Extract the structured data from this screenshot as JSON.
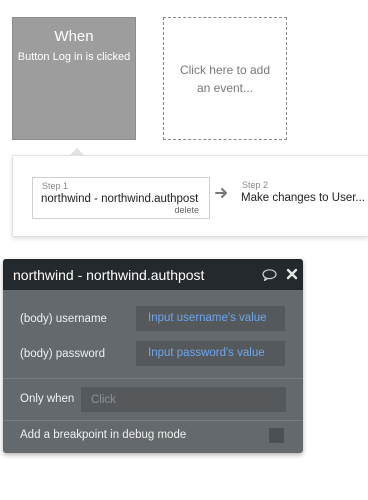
{
  "trigger": {
    "title": "When",
    "subtitle": "Button Log in is clicked"
  },
  "add_event": {
    "label": "Click here to add an event..."
  },
  "steps": [
    {
      "number": "Step 1",
      "title": "northwind - northwind.authpost",
      "delete_label": "delete"
    },
    {
      "number": "Step 2",
      "title": "Make changes to User..."
    }
  ],
  "inspector": {
    "title": "northwind - northwind.authpost",
    "params": [
      {
        "label": "(body) username",
        "value": "Input username's value"
      },
      {
        "label": "(body) password",
        "value": "Input password's value"
      }
    ],
    "only_when_label": "Only when",
    "only_when_placeholder": "Click",
    "breakpoint_label": "Add a breakpoint in debug mode",
    "icons": {
      "comment": "comment-icon",
      "close": "close-icon"
    }
  },
  "colors": {
    "trigger_bg": "#9d9d9d",
    "inspector_header": "#24292d",
    "inspector_body": "#63696d",
    "link_value": "#6ea6ec"
  }
}
